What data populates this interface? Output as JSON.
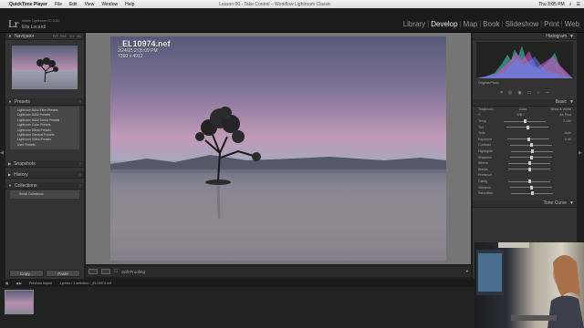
{
  "menubar": {
    "apple": "",
    "app": "QuickTime Player",
    "items": [
      "File",
      "Edit",
      "View",
      "Window",
      "Help"
    ],
    "window_title": "Lesson 06 - Take Control – Workflow Lightroom Classic",
    "clock": "Thu 3:05 PM"
  },
  "identity": {
    "logo": "Lr",
    "catalog": "Adobe Lightroom CC 2015",
    "user": "Elia Locardi"
  },
  "modules": [
    "Library",
    "Develop",
    "Map",
    "Book",
    "Slideshow",
    "Print",
    "Web"
  ],
  "left_panel": {
    "navigator": "Navigator",
    "nav_zoom": [
      "FIT",
      "FILL",
      "1:1",
      "3:1"
    ],
    "presets": "Presets",
    "preset_items": [
      "Lightroom B&W Filter Presets",
      "Lightroom B&W Presets",
      "Lightroom B&W Toned Presets",
      "Lightroom Color Presets",
      "Lightroom Effect Presets",
      "Lightroom General Presets",
      "Lightroom Video Presets",
      "User Presets"
    ],
    "snapshots": "Snapshots",
    "history": "History",
    "collections": "Collections",
    "collection_items": [
      "Smart Collections"
    ],
    "copy": "Copy...",
    "paste": "Paste"
  },
  "photo": {
    "name": "_EL10974.nef",
    "date": "2/24/15 2:05:09 PM",
    "dims": "7360 x 4912"
  },
  "toolbar": {
    "soft_proofing": "Soft Proofing"
  },
  "right_panel": {
    "histogram": "Histogram",
    "original_photo": "Original Photo",
    "basic": "Basic",
    "treatment": "Treatment :",
    "color": "Color",
    "bw": "Black & White",
    "wb": "WB :",
    "as_shot": "As Shot",
    "temp": "Temp",
    "tint": "Tint",
    "tone": "Tone",
    "auto": "Auto",
    "exposure": "Exposure",
    "contrast": "Contrast",
    "highlights": "Highlights",
    "shadows": "Shadows",
    "whites": "Whites",
    "blacks": "Blacks",
    "presence": "Presence",
    "clarity": "Clarity",
    "vibrance": "Vibrance",
    "saturation": "Saturation",
    "tone_curve": "Tone Curve",
    "temp_val": "7,100",
    "exposure_val": "0.00"
  },
  "filmstrip": {
    "source": "Previous Import",
    "info": "1 photo / 1 selected / _EL10974.nef"
  }
}
